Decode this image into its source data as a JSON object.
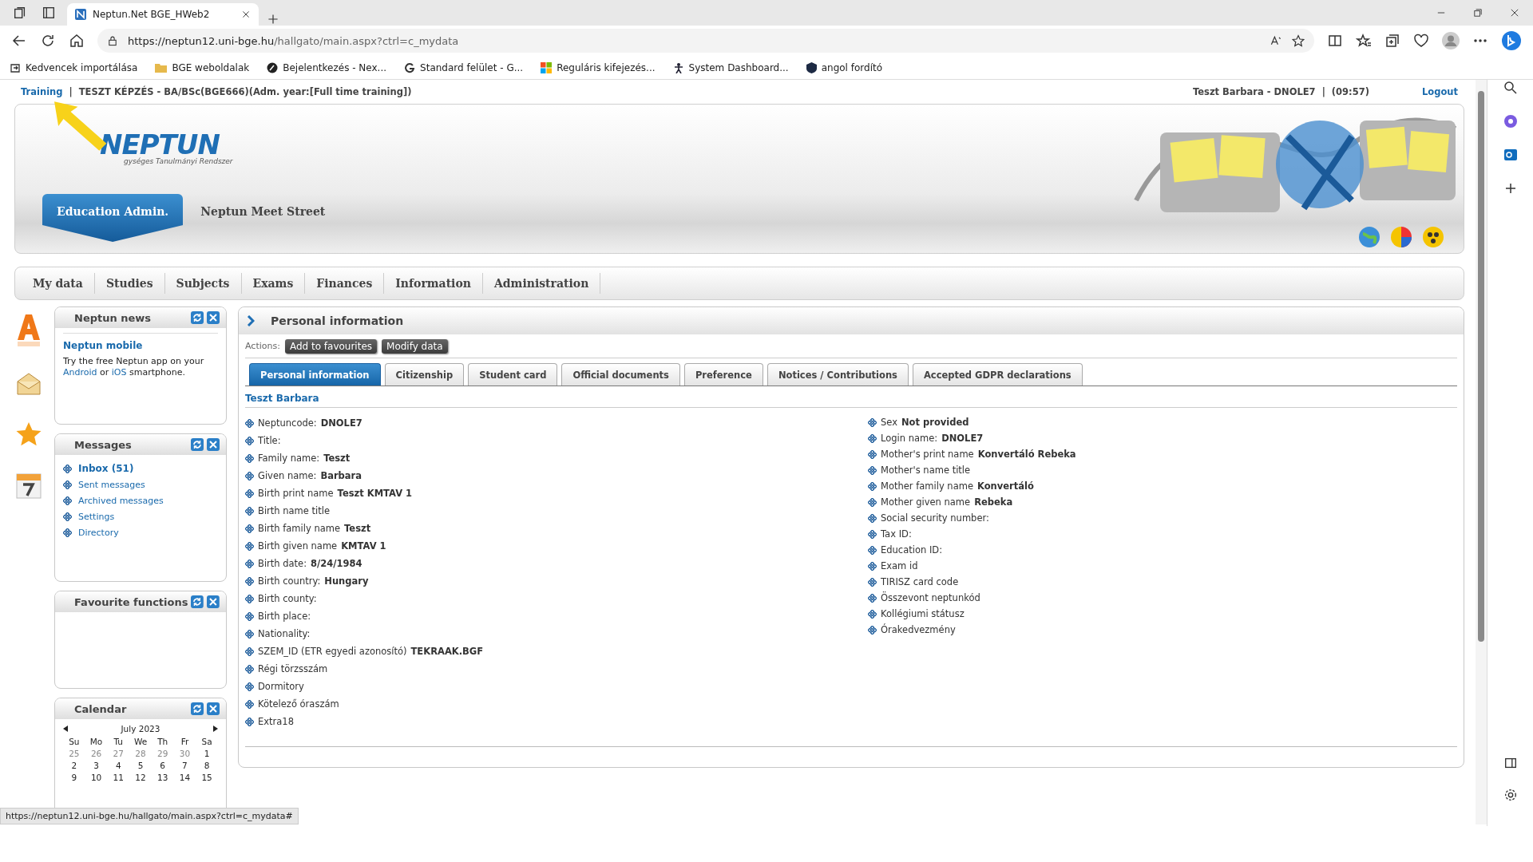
{
  "browser": {
    "tab_title": "Neptun.Net BGE_HWeb2",
    "url_host": "https://neptun12.uni-bge.hu",
    "url_path": "/hallgato/main.aspx?ctrl=c_mydata",
    "status_url": "https://neptun12.uni-bge.hu/hallgato/main.aspx?ctrl=c_mydata#",
    "bookmarks": [
      {
        "label": "Kedvencek importálása",
        "kind": "import"
      },
      {
        "label": "BGE weboldalak",
        "kind": "folder"
      },
      {
        "label": "Bejelentkezés - Nex...",
        "kind": "circle"
      },
      {
        "label": "Standard felület - G...",
        "kind": "g"
      },
      {
        "label": "Reguláris kifejezés...",
        "kind": "squares"
      },
      {
        "label": "System Dashboard...",
        "kind": "figure"
      },
      {
        "label": "angol fordító",
        "kind": "shield"
      }
    ]
  },
  "top_bar": {
    "training": "Training",
    "separator": "|",
    "program": "TESZT KÉPZÉS - BA/BSc(BGE666)(Adm. year:[Full time training])",
    "user": "Teszt Barbara - DNOLE7",
    "user_separator": "|",
    "time": "(09:57)",
    "logout": "Logout"
  },
  "header": {
    "logo": "NEPTUN",
    "logo_subtitle": "gységes Tanulmányi Rendszer",
    "tabs": [
      {
        "label": "Education Admin.",
        "selected": true
      },
      {
        "label": "Neptun Meet Street",
        "selected": false
      }
    ]
  },
  "menu": [
    "My data",
    "Studies",
    "Subjects",
    "Exams",
    "Finances",
    "Information",
    "Administration"
  ],
  "news": {
    "title": "Neptun news",
    "heading": "Neptun mobile",
    "parts": [
      {
        "kind": "text",
        "text": "Try the free Neptun app on your "
      },
      {
        "kind": "link",
        "text": "Android"
      },
      {
        "kind": "text",
        "text": " or "
      },
      {
        "kind": "link",
        "text": "iOS"
      },
      {
        "kind": "text",
        "text": " smartphone."
      }
    ]
  },
  "messages": {
    "title": "Messages",
    "items": [
      {
        "label": "Inbox (51)",
        "bold": true
      },
      {
        "label": "Sent messages",
        "bold": false
      },
      {
        "label": "Archived messages",
        "bold": false
      },
      {
        "label": "Settings",
        "bold": false
      },
      {
        "label": "Directory",
        "bold": false
      }
    ]
  },
  "favourites": {
    "title": "Favourite functions"
  },
  "calendar": {
    "title": "Calendar",
    "month": "July 2023",
    "weekdays": [
      "Su",
      "Mo",
      "Tu",
      "We",
      "Th",
      "Fr",
      "Sa"
    ],
    "weeks": [
      [
        {
          "day": "25",
          "muted": true
        },
        {
          "day": "26",
          "muted": true
        },
        {
          "day": "27",
          "muted": true
        },
        {
          "day": "28",
          "muted": true
        },
        {
          "day": "29",
          "muted": true
        },
        {
          "day": "30",
          "muted": true
        },
        {
          "day": "1",
          "muted": false
        }
      ],
      [
        {
          "day": "2",
          "muted": false
        },
        {
          "day": "3",
          "muted": false
        },
        {
          "day": "4",
          "muted": false
        },
        {
          "day": "5",
          "muted": false
        },
        {
          "day": "6",
          "muted": false
        },
        {
          "day": "7",
          "muted": false
        },
        {
          "day": "8",
          "muted": false
        }
      ],
      [
        {
          "day": "9",
          "muted": false
        },
        {
          "day": "10",
          "muted": false
        },
        {
          "day": "11",
          "muted": false
        },
        {
          "day": "12",
          "muted": false
        },
        {
          "day": "13",
          "muted": false
        },
        {
          "day": "14",
          "muted": false
        },
        {
          "day": "15",
          "muted": false
        }
      ]
    ]
  },
  "main": {
    "title": "Personal information",
    "actions_label": "Actions:",
    "actions": [
      "Add to favourites",
      "Modify data"
    ],
    "tabs": [
      {
        "label": "Personal information",
        "selected": true
      },
      {
        "label": "Citizenship",
        "selected": false
      },
      {
        "label": "Student card",
        "selected": false
      },
      {
        "label": "Official documents",
        "selected": false
      },
      {
        "label": "Preference",
        "selected": false
      },
      {
        "label": "Notices / Contributions",
        "selected": false
      },
      {
        "label": "Accepted GDPR declarations",
        "selected": false
      }
    ],
    "person": "Teszt Barbara",
    "left_fields": [
      {
        "label": "Neptuncode:",
        "value": "DNOLE7"
      },
      {
        "label": "Title:"
      },
      {
        "label": "Family name:",
        "value": "Teszt"
      },
      {
        "label": "Given name:",
        "value": "Barbara"
      },
      {
        "label": "Birth print name",
        "value": "Teszt KMTAV 1"
      },
      {
        "label": "Birth name title"
      },
      {
        "label": "Birth family name",
        "value": "Teszt"
      },
      {
        "label": "Birth given name",
        "value": "KMTAV 1"
      },
      {
        "label": "Birth date:",
        "value": "8/24/1984"
      },
      {
        "label": "Birth country:",
        "value": "Hungary"
      },
      {
        "label": "Birth county:"
      },
      {
        "label": "Birth place:"
      },
      {
        "label": "Nationality:"
      },
      {
        "label": "SZEM_ID (ETR egyedi azonosító)",
        "value": "TEKRAAK.BGF"
      },
      {
        "label": "Régi törzsszám"
      },
      {
        "label": "Dormitory"
      },
      {
        "label": "Kötelező óraszám"
      },
      {
        "label": "Extra18"
      }
    ],
    "right_fields": [
      {
        "label": "Sex",
        "value": "Not provided"
      },
      {
        "label": "Login name:",
        "value": "DNOLE7"
      },
      {
        "label": "Mother's print name",
        "value": "Konvertáló Rebeka"
      },
      {
        "label": "Mother's name title"
      },
      {
        "label": "Mother family name",
        "value": "Konvertáló"
      },
      {
        "label": "Mother given name",
        "value": "Rebeka"
      },
      {
        "label": "Social security number:"
      },
      {
        "label": "Tax ID:"
      },
      {
        "label": "Education ID:"
      },
      {
        "label": "Exam id"
      },
      {
        "label": "TIRISZ card code"
      },
      {
        "label": "Összevont neptunkód"
      },
      {
        "label": "Kollégiumi státusz"
      },
      {
        "label": "Órakedvezmény"
      }
    ]
  }
}
